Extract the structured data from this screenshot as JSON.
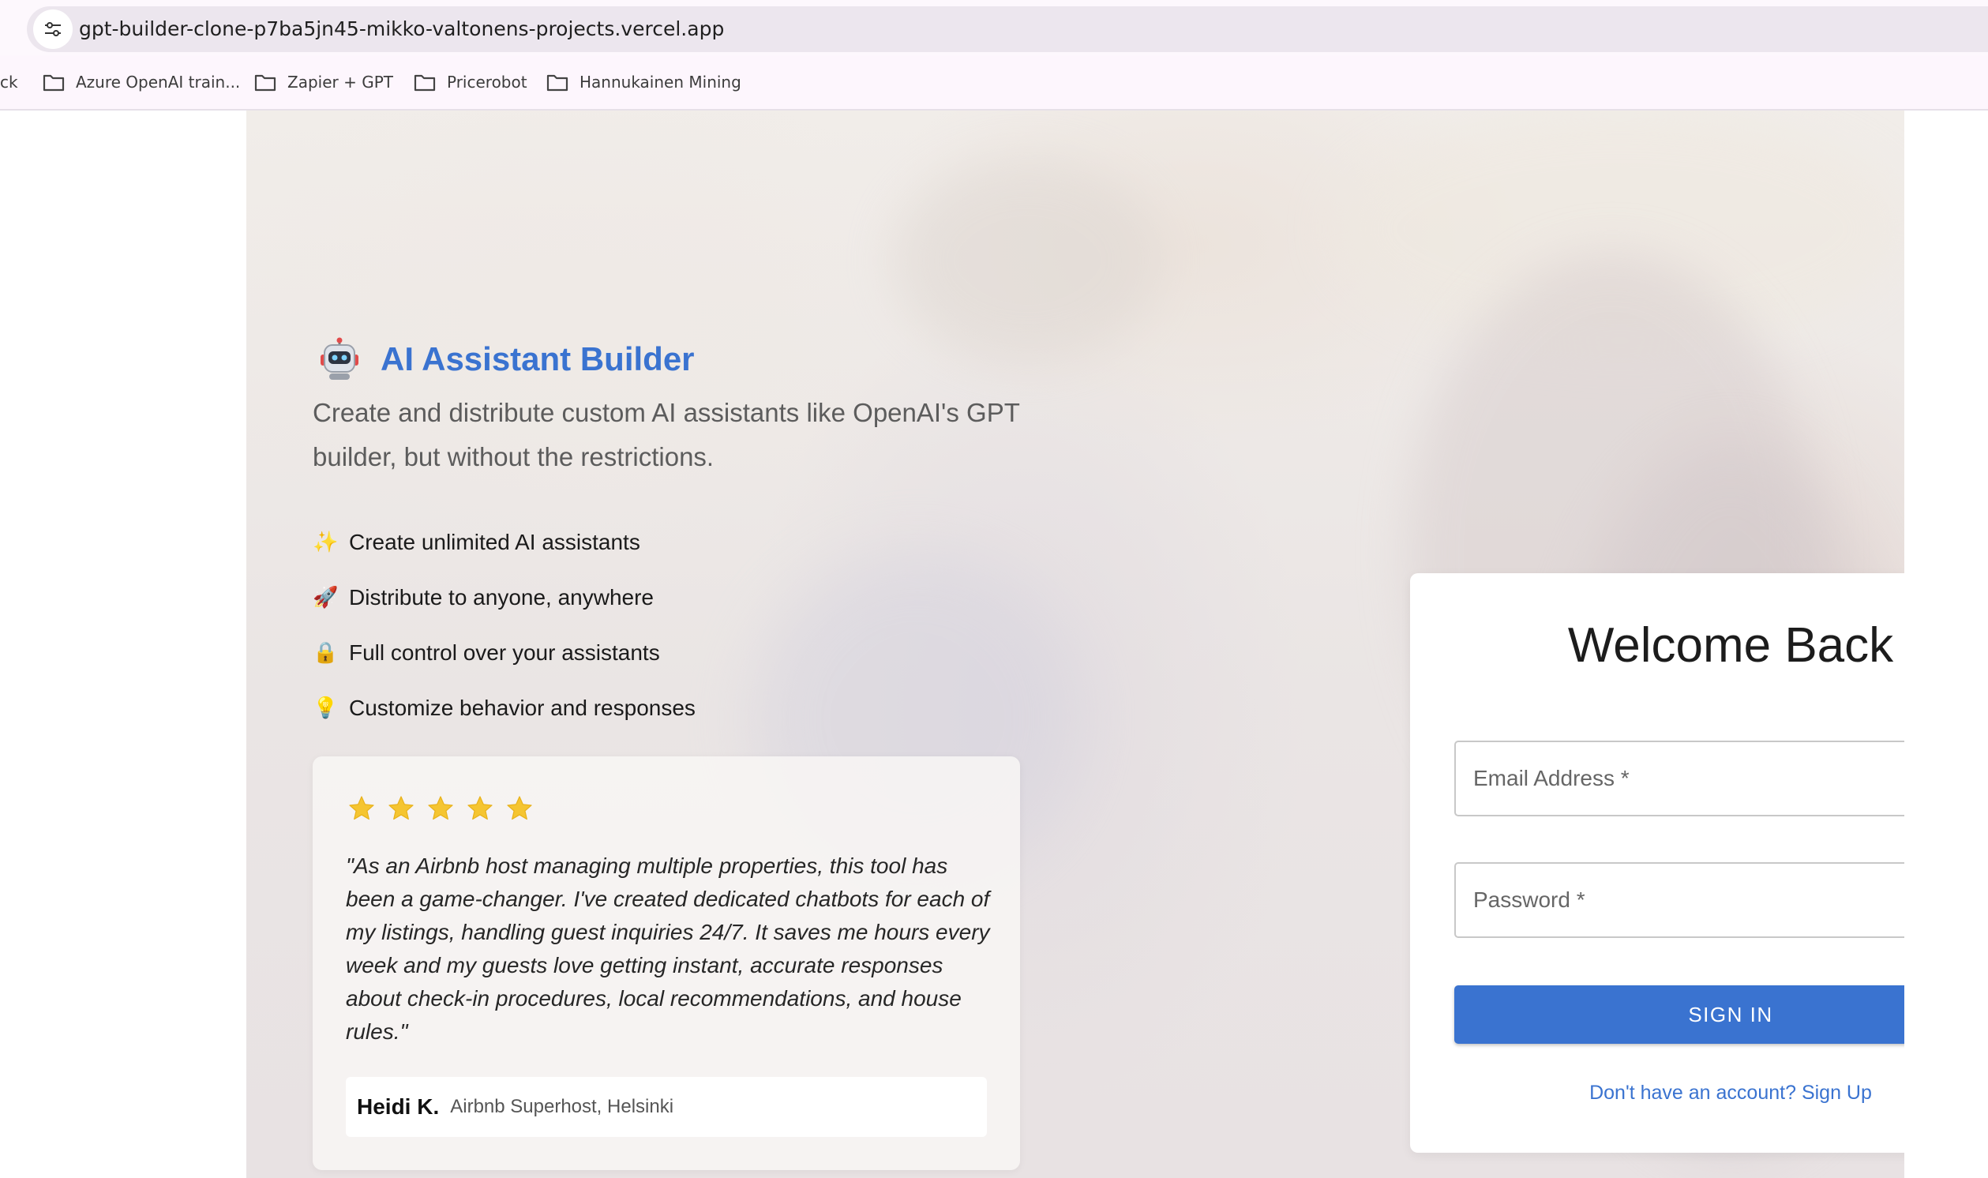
{
  "browser": {
    "url": "gpt-builder-clone-p7ba5jn45-mikko-valtonens-projects.vercel.app",
    "bookmarks": [
      {
        "label": "ck",
        "icon": "none"
      },
      {
        "label": "Azure OpenAI train...",
        "icon": "folder-icon"
      },
      {
        "label": "Zapier + GPT",
        "icon": "folder-icon"
      },
      {
        "label": "Pricerobot",
        "icon": "folder-icon"
      },
      {
        "label": "Hannukainen Mining",
        "icon": "folder-icon"
      }
    ]
  },
  "hero": {
    "icon": "robot-icon",
    "title": "AI Assistant Builder",
    "subtitle": "Create and distribute custom AI assistants like OpenAI's GPT builder, but without the restrictions.",
    "features": [
      {
        "emoji": "✨",
        "text": "Create unlimited AI assistants"
      },
      {
        "emoji": "🚀",
        "text": "Distribute to anyone, anywhere"
      },
      {
        "emoji": "🔒",
        "text": "Full control over your assistants"
      },
      {
        "emoji": "💡",
        "text": "Customize behavior and responses"
      }
    ],
    "testimonial": {
      "rating": 5,
      "quote": "\"As an Airbnb host managing multiple properties, this tool has been a game-changer. I've created dedicated chatbots for each of my listings, handling guest inquiries 24/7. It saves me hours every week and my guests love getting instant, accurate responses about check-in procedures, local recommendations, and house rules.\"",
      "author": "Heidi K.",
      "role": "Airbnb Superhost, Helsinki"
    }
  },
  "login": {
    "title": "Welcome Back",
    "email_placeholder": "Email Address *",
    "password_placeholder": "Password *",
    "signin_label": "SIGN IN",
    "signup_link": "Don't have an account? Sign Up"
  },
  "colors": {
    "accent": "#3a73d0",
    "star": "#f5c531"
  }
}
